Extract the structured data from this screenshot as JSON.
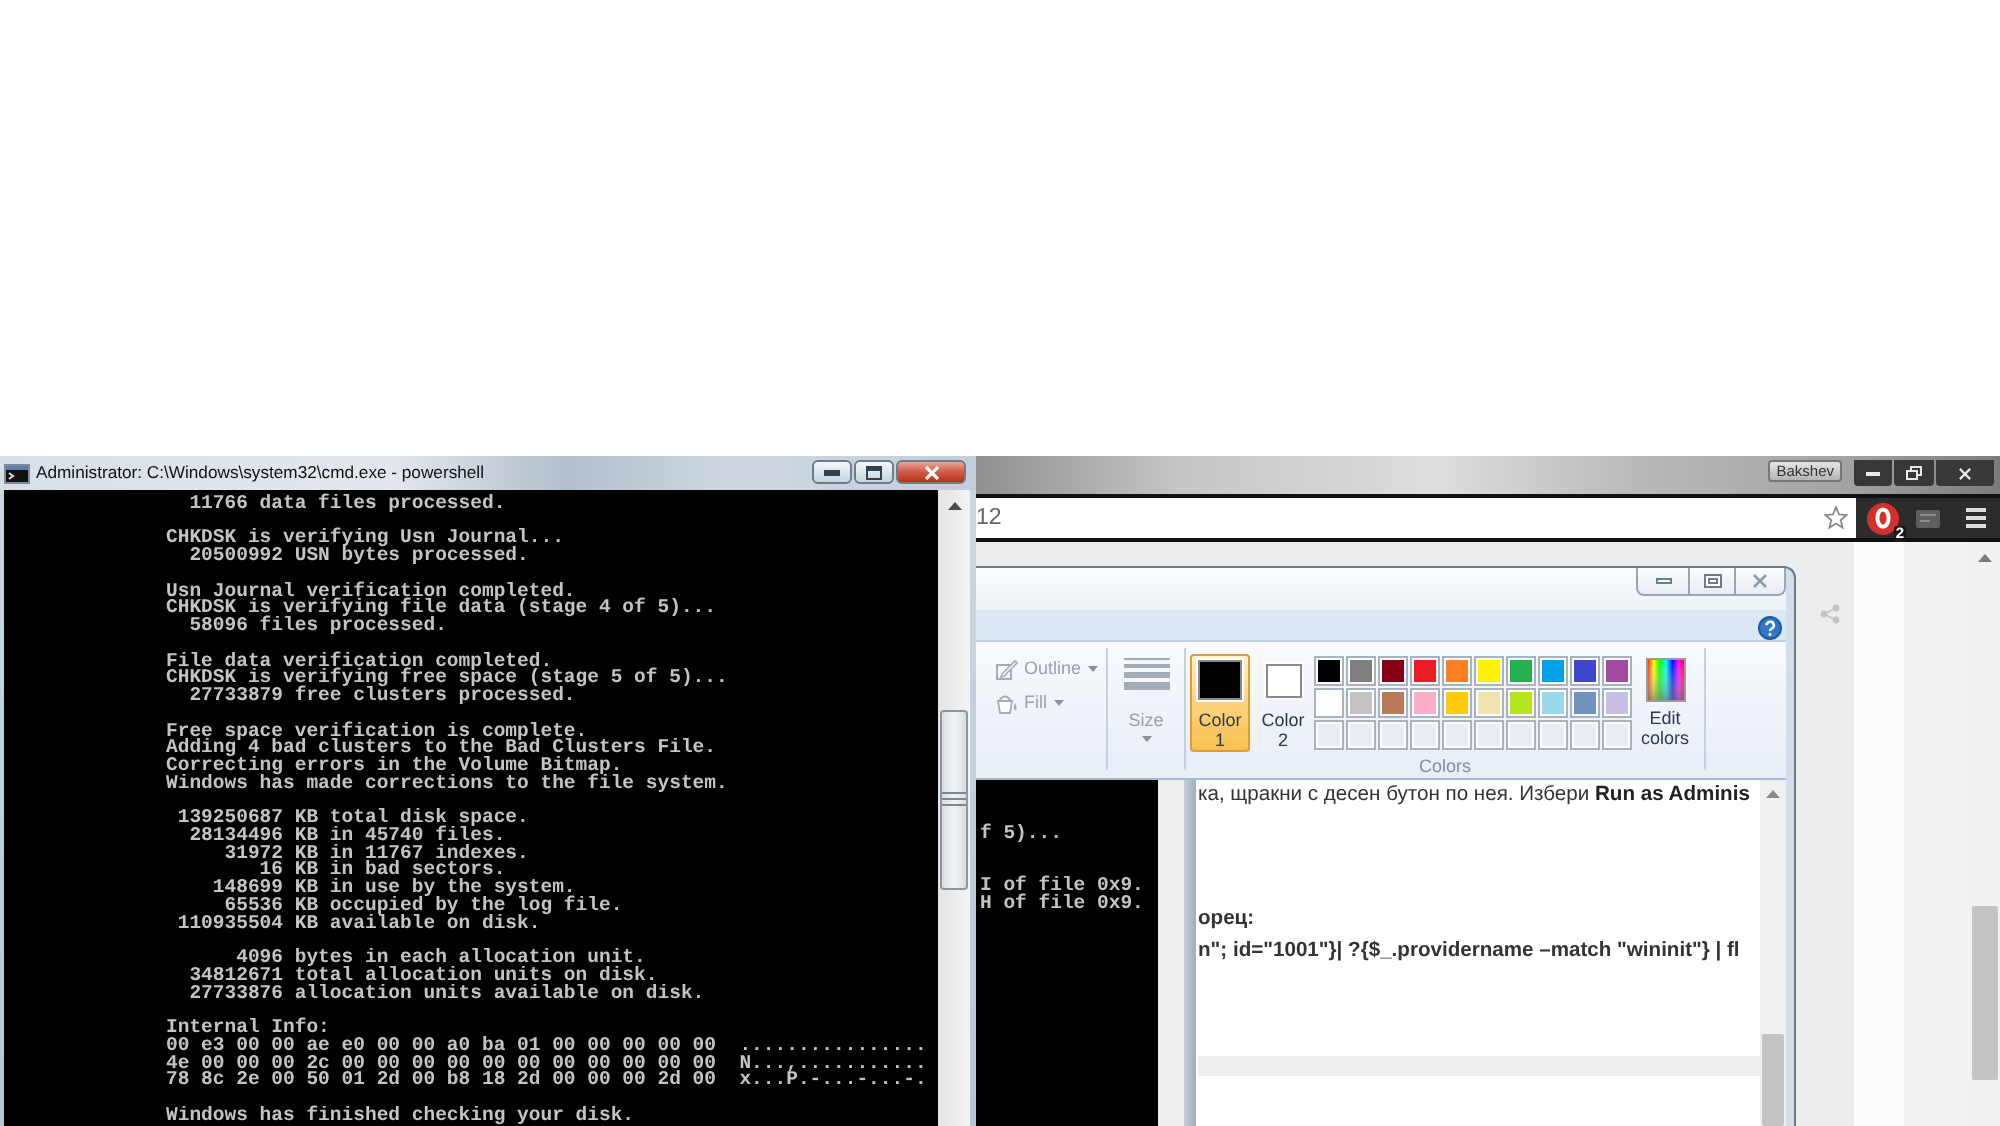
{
  "console_window": {
    "title": "Administrator: C:\\Windows\\system32\\cmd.exe - powershell",
    "output_blocks": [
      [
        "  11766 data files processed."
      ],
      [
        "CHKDSK is verifying Usn Journal...",
        "  20500992 USN bytes processed."
      ],
      [
        "Usn Journal verification completed.",
        "CHKDSK is verifying file data (stage 4 of 5)...",
        "  58096 files processed."
      ],
      [
        "File data verification completed.",
        "CHKDSK is verifying free space (stage 5 of 5)...",
        "  27733879 free clusters processed."
      ],
      [
        "Free space verification is complete.",
        "Adding 4 bad clusters to the Bad Clusters File.",
        "Correcting errors in the Volume Bitmap.",
        "Windows has made corrections to the file system."
      ],
      [
        " 139250687 KB total disk space.",
        "  28134496 KB in 45740 files.",
        "     31972 KB in 11767 indexes.",
        "        16 KB in bad sectors.",
        "    148699 KB in use by the system.",
        "     65536 KB occupied by the log file.",
        " 110935504 KB available on disk."
      ],
      [
        "      4096 bytes in each allocation unit.",
        "  34812671 total allocation units on disk.",
        "  27733876 allocation units available on disk."
      ],
      [
        "Internal Info:",
        "00 e3 00 00 ae e0 00 00 a0 ba 01 00 00 00 00 00  ................",
        "4e 00 00 00 2c 00 00 00 00 00 00 00 00 00 00 00  N...,...........",
        "78 8c 2e 00 50 01 2d 00 b8 18 2d 00 00 00 2d 00  x...P.-...-...-."
      ],
      [
        "Windows has finished checking your disk."
      ]
    ]
  },
  "browser_window": {
    "profile_name": "Bakshev",
    "address": "12",
    "extension_badge": "2"
  },
  "paint_window": {
    "ribbon": {
      "shape_tools": [
        {
          "kind": "outline",
          "label": "Outline",
          "disabled": true
        },
        {
          "kind": "fill",
          "label": "Fill",
          "disabled": true
        }
      ],
      "size": {
        "label": "Size",
        "disabled": true
      },
      "color_slots": [
        {
          "kind": "primary",
          "label": "Color 1",
          "color": "#000000",
          "selected": true
        },
        {
          "kind": "secondary",
          "label": "Color 2",
          "color": "#ffffff",
          "selected": false
        }
      ],
      "palette": [
        {
          "kind": "swatch",
          "color": "#000000"
        },
        {
          "kind": "swatch",
          "color": "#7f7f7f"
        },
        {
          "kind": "swatch",
          "color": "#880015"
        },
        {
          "kind": "swatch",
          "color": "#ed1c24"
        },
        {
          "kind": "swatch",
          "color": "#ff7f27"
        },
        {
          "kind": "swatch",
          "color": "#fff200"
        },
        {
          "kind": "swatch",
          "color": "#22b14c"
        },
        {
          "kind": "swatch",
          "color": "#00a2e8"
        },
        {
          "kind": "swatch",
          "color": "#3f48cc"
        },
        {
          "kind": "swatch",
          "color": "#a349a4"
        },
        {
          "kind": "swatch",
          "color": "#ffffff"
        },
        {
          "kind": "swatch",
          "color": "#c3c3c3"
        },
        {
          "kind": "swatch",
          "color": "#b97a57"
        },
        {
          "kind": "swatch",
          "color": "#ffaec9"
        },
        {
          "kind": "swatch",
          "color": "#ffc90e"
        },
        {
          "kind": "swatch",
          "color": "#efe4b0"
        },
        {
          "kind": "swatch",
          "color": "#b5e61d"
        },
        {
          "kind": "swatch",
          "color": "#99d9ea"
        },
        {
          "kind": "swatch",
          "color": "#7092be"
        },
        {
          "kind": "swatch",
          "color": "#c8bfe7"
        },
        {
          "kind": "empty"
        },
        {
          "kind": "empty"
        },
        {
          "kind": "empty"
        },
        {
          "kind": "empty"
        },
        {
          "kind": "empty"
        },
        {
          "kind": "empty"
        },
        {
          "kind": "empty"
        },
        {
          "kind": "empty"
        },
        {
          "kind": "empty"
        },
        {
          "kind": "empty"
        }
      ],
      "edit_colors": "Edit colors",
      "group_label": "Colors"
    },
    "canvas": {
      "console_blocks": [
        [
          "f 5)..."
        ],
        [
          "I of file 0x9.",
          "H of file 0x9."
        ]
      ],
      "page_blocks": [
        [
          {
            "kind": "paragraph",
            "text": "ка, щракни с десен бутон по нея. Избери **Run as Adminis**"
          }
        ],
        [
          {
            "kind": "heading",
            "text": "орец:"
          },
          {
            "kind": "code",
            "text": "n\"; id=\"1001\"}| ?{$_.providername –match \"wininit\"} | fl"
          }
        ]
      ]
    }
  }
}
